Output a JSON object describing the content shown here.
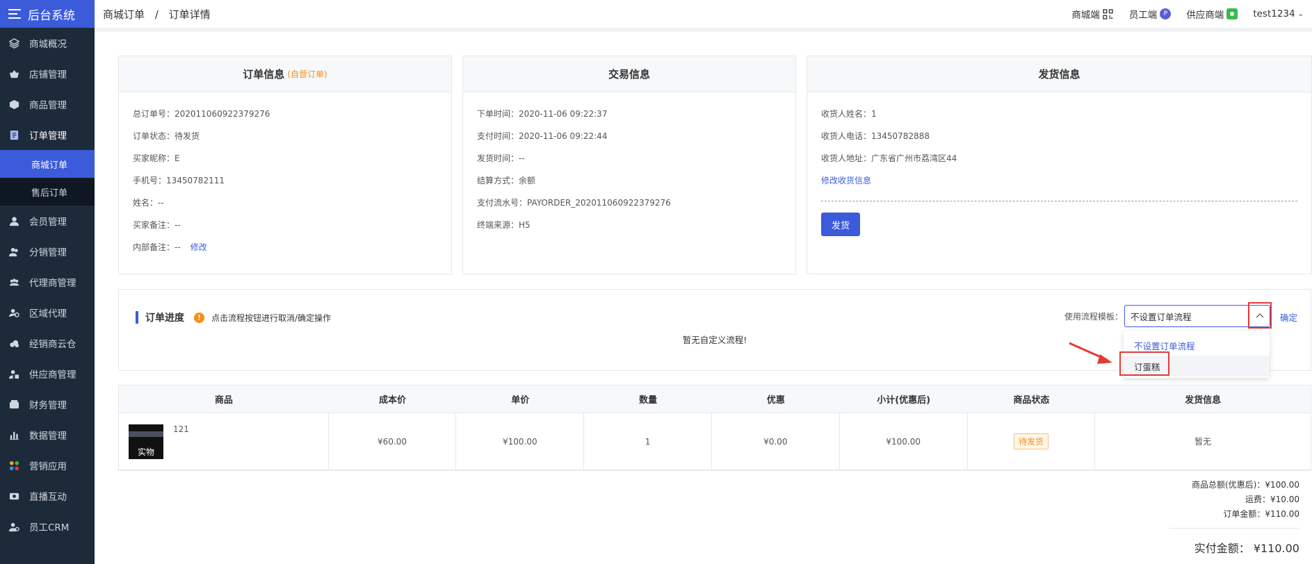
{
  "sidebar": {
    "brand": "后台系统",
    "items": [
      {
        "label": "商城概况",
        "icon": "layers-icon"
      },
      {
        "label": "店铺管理",
        "icon": "shop-basket-icon"
      },
      {
        "label": "商品管理",
        "icon": "box-icon"
      },
      {
        "label": "订单管理",
        "icon": "order-doc-icon"
      },
      {
        "label": "会员管理",
        "icon": "user-icon"
      },
      {
        "label": "分销管理",
        "icon": "users-icon"
      },
      {
        "label": "代理商管理",
        "icon": "group-icon"
      },
      {
        "label": "区域代理",
        "icon": "location-user-icon"
      },
      {
        "label": "经销商云仓",
        "icon": "cloud-icon"
      },
      {
        "label": "供应商管理",
        "icon": "supplier-icon"
      },
      {
        "label": "财务管理",
        "icon": "wallet-icon"
      },
      {
        "label": "数据管理",
        "icon": "chart-icon"
      },
      {
        "label": "营销应用",
        "icon": "apps-icon"
      },
      {
        "label": "直播互动",
        "icon": "video-icon"
      },
      {
        "label": "员工CRM",
        "icon": "crm-icon"
      }
    ],
    "sub_items": [
      "商城订单",
      "售后订单"
    ]
  },
  "header": {
    "crumb_parent": "商城订单",
    "crumb_sep": "/",
    "crumb_current": "订单详情",
    "mall_end": "商城端",
    "staff_end": "员工端",
    "supplier_end": "供应商端",
    "user": "test1234"
  },
  "order_info": {
    "title": "订单信息",
    "tag": "(自营订单)",
    "rows": [
      "总订单号：202011060922379276",
      "订单状态：待发货",
      "买家昵称：E",
      "手机号：13450782111",
      "姓名：--",
      "买家备注：--",
      "内部备注：--"
    ],
    "edit_link": "修改"
  },
  "trade_info": {
    "title": "交易信息",
    "rows": [
      "下单时间：2020-11-06 09:22:37",
      "支付时间：2020-11-06 09:22:44",
      "发货时间：--",
      "结算方式：余额",
      "支付流水号：PAYORDER_202011060922379276",
      "终端来源：H5"
    ]
  },
  "ship_info": {
    "title": "发货信息",
    "rows": [
      "收货人姓名：1",
      "收货人电话：13450782888",
      "收货人地址：广东省广州市荔湾区44"
    ],
    "edit_link": "修改收货信息",
    "ship_button": "发货"
  },
  "progress": {
    "title": "订单进度",
    "hint": "点击流程按钮进行取消/确定操作",
    "empty": "暂无自定义流程!",
    "template_label": "使用流程模板：",
    "selected": "不设置订单流程",
    "confirm": "确定",
    "options": [
      "不设置订单流程",
      "订蛋糕"
    ]
  },
  "table": {
    "headers": [
      "商品",
      "成本价",
      "单价",
      "数量",
      "优惠",
      "小计(优惠后)",
      "商品状态",
      "发货信息"
    ],
    "row": {
      "thumb_label": "实物",
      "name": "121",
      "cost": "¥60.00",
      "price": "¥100.00",
      "qty": "1",
      "discount": "¥0.00",
      "subtotal": "¥100.00",
      "status": "待发货",
      "ship": "暂无"
    }
  },
  "summary": {
    "goods_total": "商品总额(优惠后)：¥100.00",
    "freight": "运费：¥10.00",
    "order_amount": "订单金额：¥110.00",
    "paid": "实付金额：  ¥110.00"
  },
  "colors": {
    "primary": "#3b5bdb",
    "sidebar": "#1d2a3a",
    "warning": "#fa8c16",
    "highlight": "#e53935"
  }
}
